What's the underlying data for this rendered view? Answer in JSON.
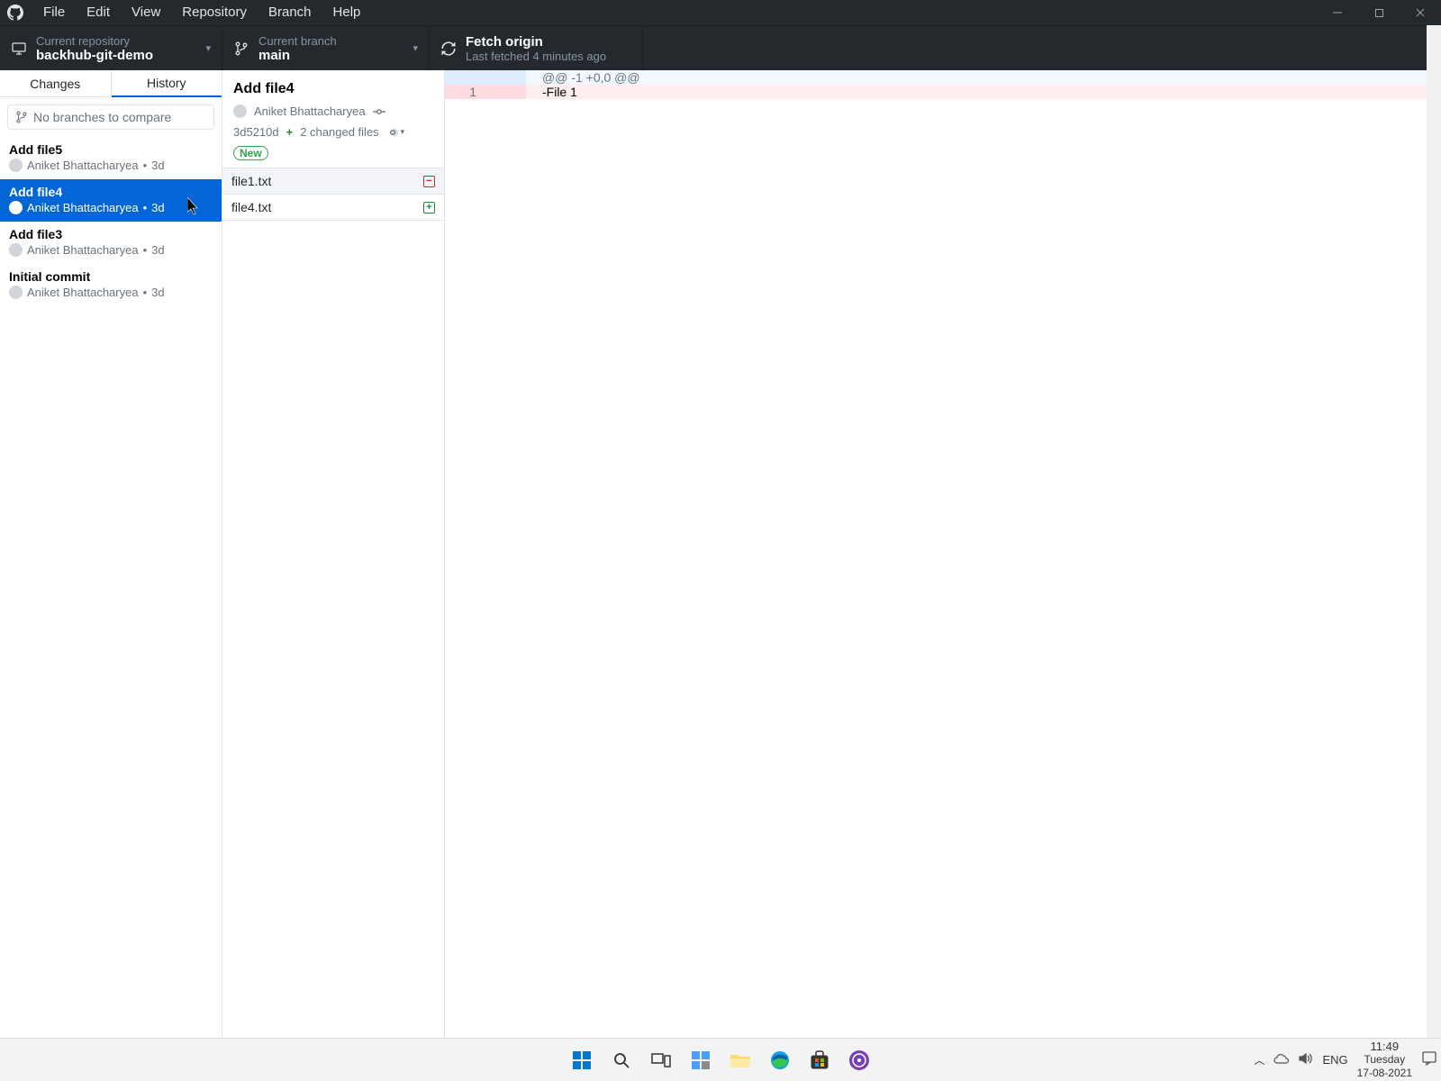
{
  "menu": {
    "file": "File",
    "edit": "Edit",
    "view": "View",
    "repository": "Repository",
    "branch": "Branch",
    "help": "Help"
  },
  "toolbar": {
    "repo_label": "Current repository",
    "repo_value": "backhub-git-demo",
    "branch_label": "Current branch",
    "branch_value": "main",
    "fetch_label": "Fetch origin",
    "fetch_status": "Last fetched 4 minutes ago"
  },
  "tabs": {
    "changes": "Changes",
    "history": "History"
  },
  "branch_compare_placeholder": "No branches to compare",
  "commits": [
    {
      "title": "Add file5",
      "author": "Aniket Bhattacharyea",
      "time": "3d",
      "selected": false
    },
    {
      "title": "Add file4",
      "author": "Aniket Bhattacharyea",
      "time": "3d",
      "selected": true
    },
    {
      "title": "Add file3",
      "author": "Aniket Bhattacharyea",
      "time": "3d",
      "selected": false
    },
    {
      "title": "Initial commit",
      "author": "Aniket Bhattacharyea",
      "time": "3d",
      "selected": false
    }
  ],
  "commit_detail": {
    "title": "Add file4",
    "author": "Aniket Bhattacharyea",
    "sha": "3d5210d",
    "changed_files": "2 changed files",
    "badge": "New"
  },
  "files": [
    {
      "name": "file1.txt",
      "status": "deleted",
      "selected": true
    },
    {
      "name": "file4.txt",
      "status": "added",
      "selected": false
    }
  ],
  "diff": {
    "hunk": "@@ -1 +0,0 @@",
    "lines": [
      {
        "old": "1",
        "new": "",
        "type": "removed",
        "content": "-File 1"
      }
    ]
  },
  "tray": {
    "lang": "ENG",
    "time": "11:49",
    "day": "Tuesday",
    "date": "17-08-2021"
  }
}
